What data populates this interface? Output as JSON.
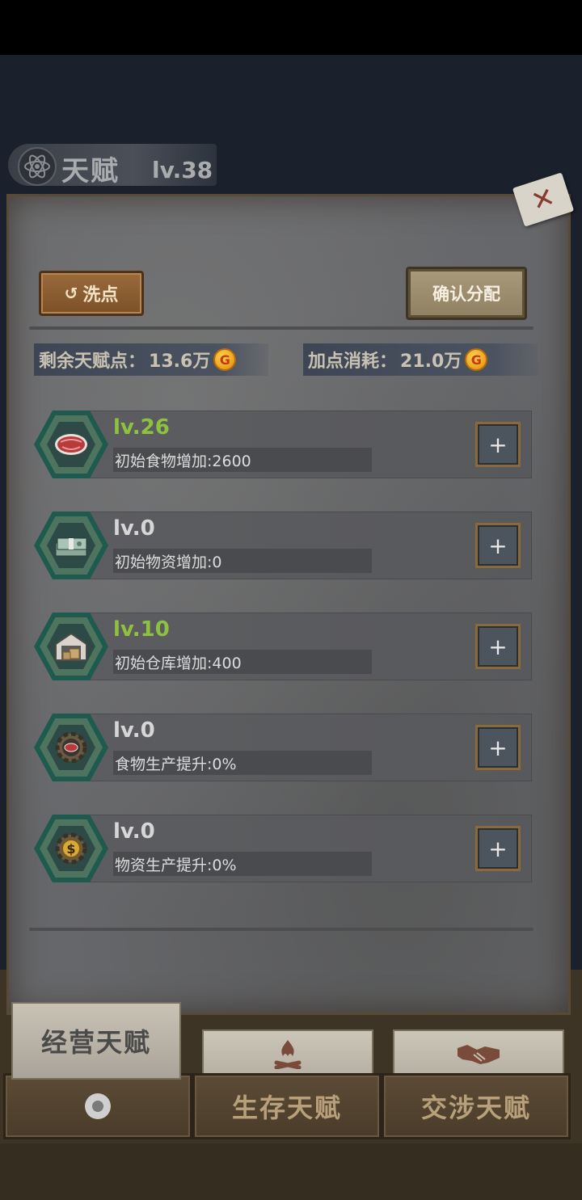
{
  "header": {
    "title": "天赋",
    "level": "lv.38"
  },
  "actions": {
    "reset_label": "洗点",
    "reset_icon": "↺",
    "confirm_label": "确认分配"
  },
  "stats": {
    "remaining_label": "剩余天赋点：",
    "remaining_value": "13.6万",
    "cost_label": "加点消耗：",
    "cost_value": "21.0万",
    "coin_symbol": "G"
  },
  "talents": [
    {
      "level": "lv.26",
      "description": "初始食物增加:2600",
      "active": true,
      "icon": "steak-icon"
    },
    {
      "level": "lv.0",
      "description": "初始物资增加:0",
      "active": false,
      "icon": "cash-stack-icon"
    },
    {
      "level": "lv.10",
      "description": "初始仓库增加:400",
      "active": true,
      "icon": "warehouse-icon"
    },
    {
      "level": "lv.0",
      "description": "食物生产提升:0%",
      "active": false,
      "icon": "food-gear-icon"
    },
    {
      "level": "lv.0",
      "description": "物资生产提升:0%",
      "active": false,
      "icon": "money-gear-icon"
    }
  ],
  "plus_symbol": "+",
  "tabs": {
    "active_label": "经营天赋",
    "survival_label": "生存天赋",
    "negotiation_label": "交涉天赋"
  },
  "colors": {
    "active_level": "#8ec23e",
    "inactive_level": "#d6d6d6",
    "hex_border": "#1f5a4e"
  }
}
